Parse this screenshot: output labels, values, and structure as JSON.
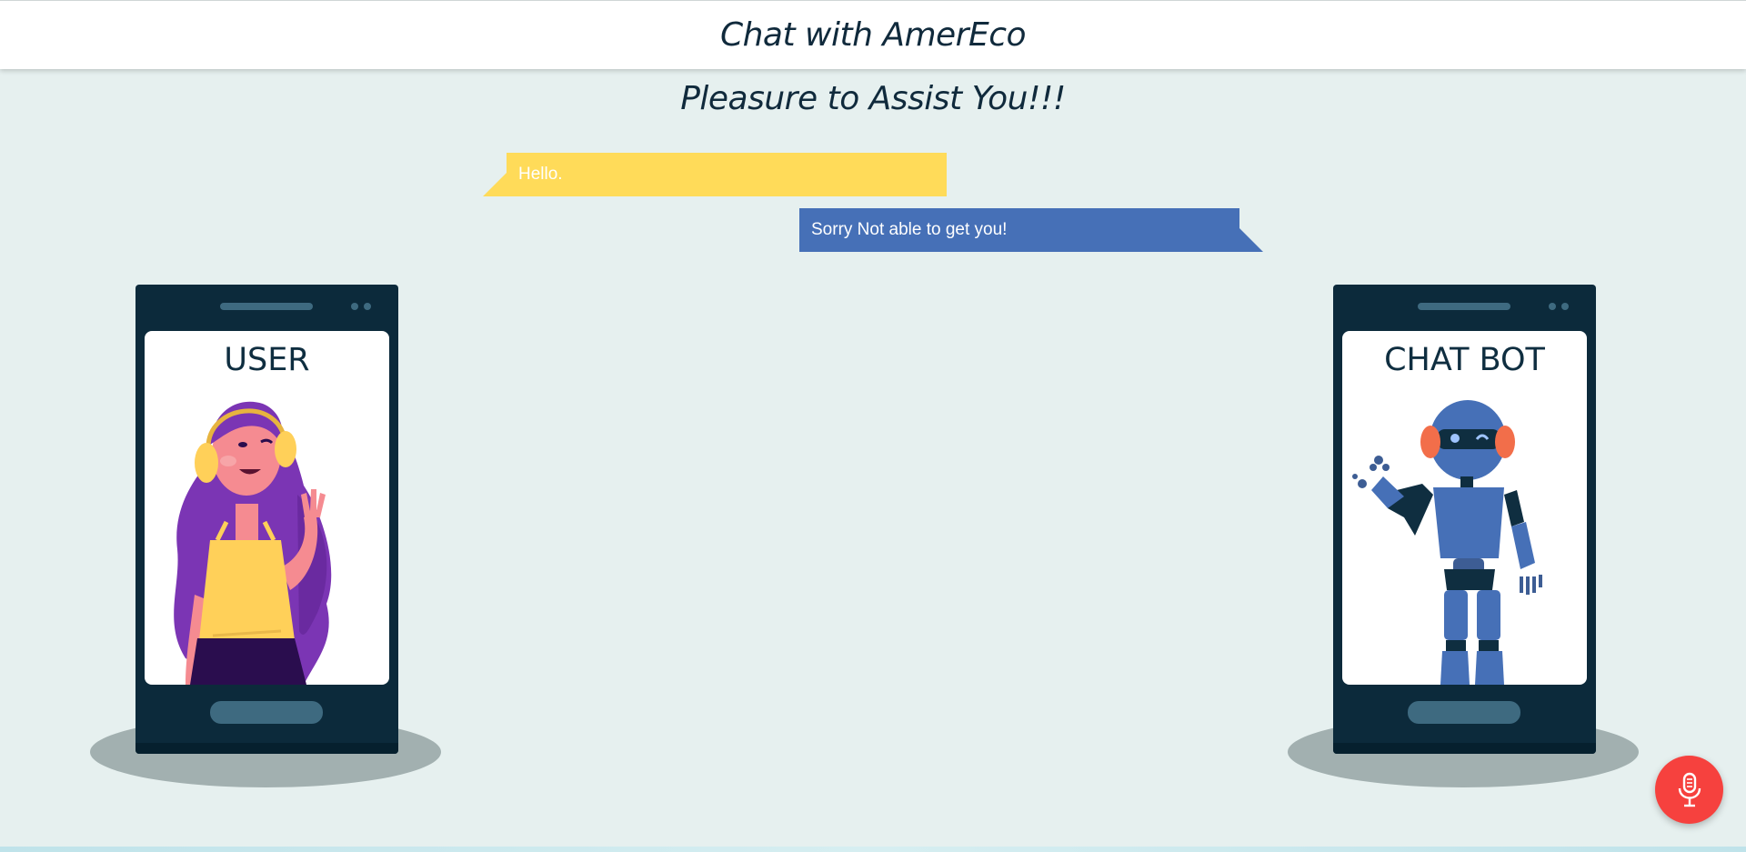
{
  "header": {
    "title": "Chat with AmerEco"
  },
  "subtitle": "Pleasure to Assist You!!!",
  "chat": {
    "messages": [
      {
        "sender": "user",
        "text": "Hello."
      },
      {
        "sender": "bot",
        "text": "Sorry Not able to get you!"
      }
    ]
  },
  "user_panel": {
    "label": "USER"
  },
  "bot_panel": {
    "label": "CHAT BOT"
  },
  "mic": {
    "icon": "microphone-icon"
  },
  "colors": {
    "background": "#e6f0ef",
    "user_bubble": "#ffdb59",
    "bot_bubble": "#4670b7",
    "phone": "#0c2a3b",
    "mic_button": "#f6413e",
    "text_dark": "#102a3c"
  }
}
